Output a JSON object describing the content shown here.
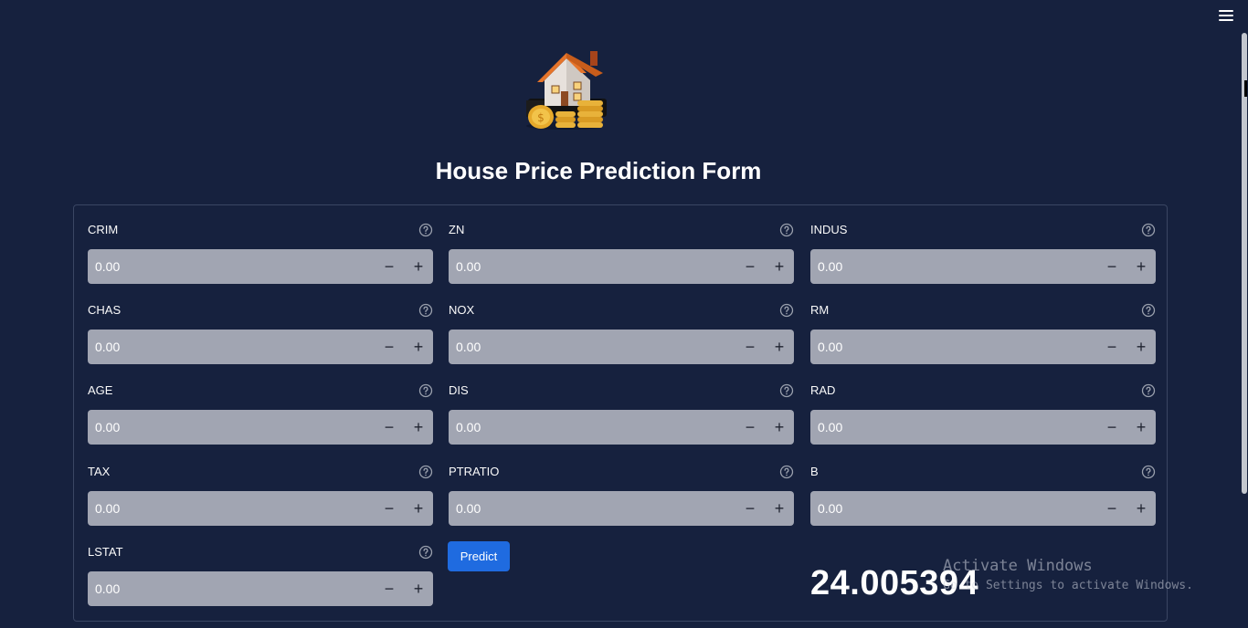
{
  "page_title": "House Price Prediction Form",
  "menu_icon": "hamburger-menu-icon",
  "fields": [
    {
      "label": "CRIM",
      "value": "0.00"
    },
    {
      "label": "ZN",
      "value": "0.00"
    },
    {
      "label": "INDUS",
      "value": "0.00"
    },
    {
      "label": "CHAS",
      "value": "0.00"
    },
    {
      "label": "NOX",
      "value": "0.00"
    },
    {
      "label": "RM",
      "value": "0.00"
    },
    {
      "label": "AGE",
      "value": "0.00"
    },
    {
      "label": "DIS",
      "value": "0.00"
    },
    {
      "label": "RAD",
      "value": "0.00"
    },
    {
      "label": "TAX",
      "value": "0.00"
    },
    {
      "label": "PTRATIO",
      "value": "0.00"
    },
    {
      "label": "B",
      "value": "0.00"
    },
    {
      "label": "LSTAT",
      "value": "0.00"
    }
  ],
  "stepper": {
    "minus": "−",
    "plus": "+"
  },
  "predict_label": "Predict",
  "result": "24.005394",
  "watermark": {
    "line1": "Activate Windows",
    "line2": "Go to Settings to activate Windows."
  },
  "colors": {
    "background": "#16213e",
    "input": "#a1a5b2",
    "button": "#1f6be0"
  }
}
